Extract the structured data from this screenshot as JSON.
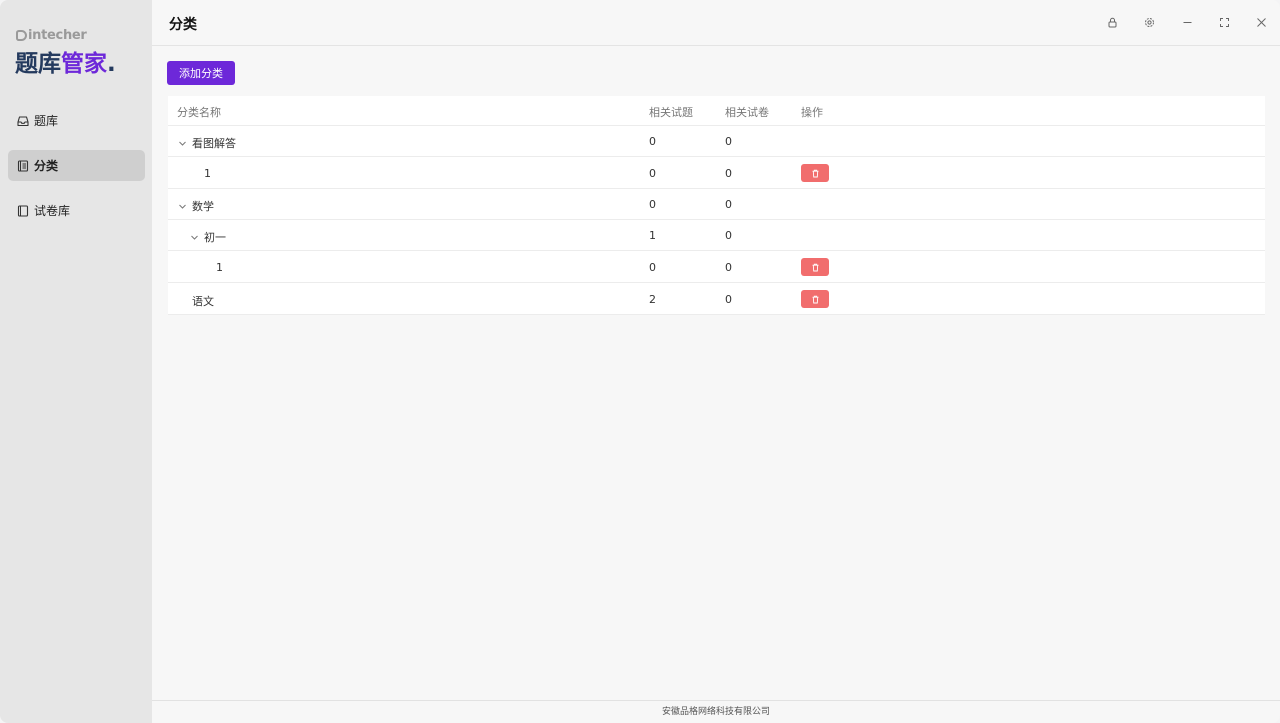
{
  "app": {
    "brand": "intecher",
    "title_main": "题库",
    "title_accent": "管家",
    "title_dot": "."
  },
  "sidebar": {
    "items": [
      {
        "label": "题库",
        "icon": "inbox-icon"
      },
      {
        "label": "分类",
        "icon": "document-list-icon",
        "active": true
      },
      {
        "label": "试卷库",
        "icon": "book-icon"
      }
    ]
  },
  "header": {
    "title": "分类",
    "controls": [
      "lock-icon",
      "settings-icon",
      "minimize-icon",
      "maximize-icon",
      "close-icon"
    ]
  },
  "toolbar": {
    "add_label": "添加分类"
  },
  "table": {
    "columns": [
      "分类名称",
      "相关试题",
      "相关试卷",
      "操作"
    ],
    "rows": [
      {
        "name": "看图解答",
        "questions": "0",
        "papers": "0",
        "expanded": true,
        "level": 0,
        "deletable": false
      },
      {
        "name": "1",
        "questions": "0",
        "papers": "0",
        "level": 1,
        "deletable": true
      },
      {
        "name": "数学",
        "questions": "0",
        "papers": "0",
        "expanded": true,
        "level": 0,
        "deletable": false
      },
      {
        "name": "初一",
        "questions": "1",
        "papers": "0",
        "expanded": true,
        "level": 1,
        "deletable": false
      },
      {
        "name": "1",
        "questions": "0",
        "papers": "0",
        "level": 2,
        "deletable": true
      },
      {
        "name": "语文",
        "questions": "2",
        "papers": "0",
        "level": 0,
        "deletable": true
      }
    ]
  },
  "footer": {
    "text": "安徽品格网络科技有限公司"
  },
  "colors": {
    "accent": "#6d28d9",
    "danger": "#f16d6d",
    "sidebar_bg": "#e6e6e6",
    "active_bg": "#cfcfcf"
  }
}
